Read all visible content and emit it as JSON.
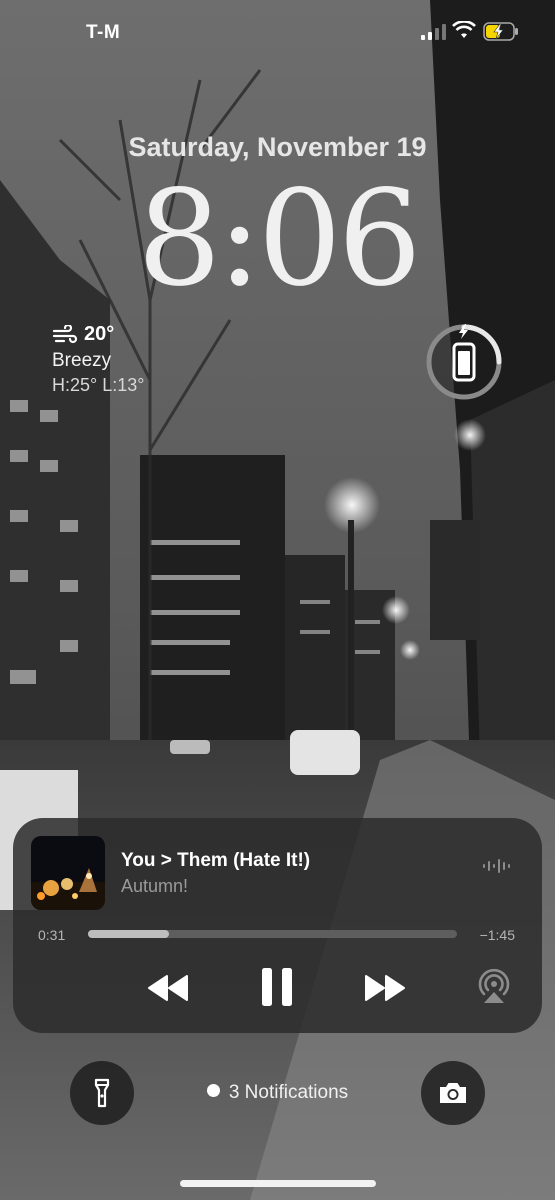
{
  "status_bar": {
    "carrier": "T-M",
    "battery_state": "charging"
  },
  "lock_screen": {
    "date": "Saturday, November 19",
    "time": "8:06"
  },
  "weather": {
    "temperature": "20°",
    "condition": "Breezy",
    "high_low": "H:25° L:13°",
    "icon": "wind-icon"
  },
  "battery_widget": {
    "icon": "phone-icon",
    "charging": true
  },
  "now_playing": {
    "title": "You > Them (Hate It!)",
    "artist": "Autumn!",
    "elapsed": "0:31",
    "remaining": "−1:45",
    "progress": 0.22
  },
  "bottom": {
    "notifications": "3 Notifications"
  },
  "colors": {
    "charging_yellow": "#f7d600",
    "battery_green_ring": "#7a7a7a"
  }
}
